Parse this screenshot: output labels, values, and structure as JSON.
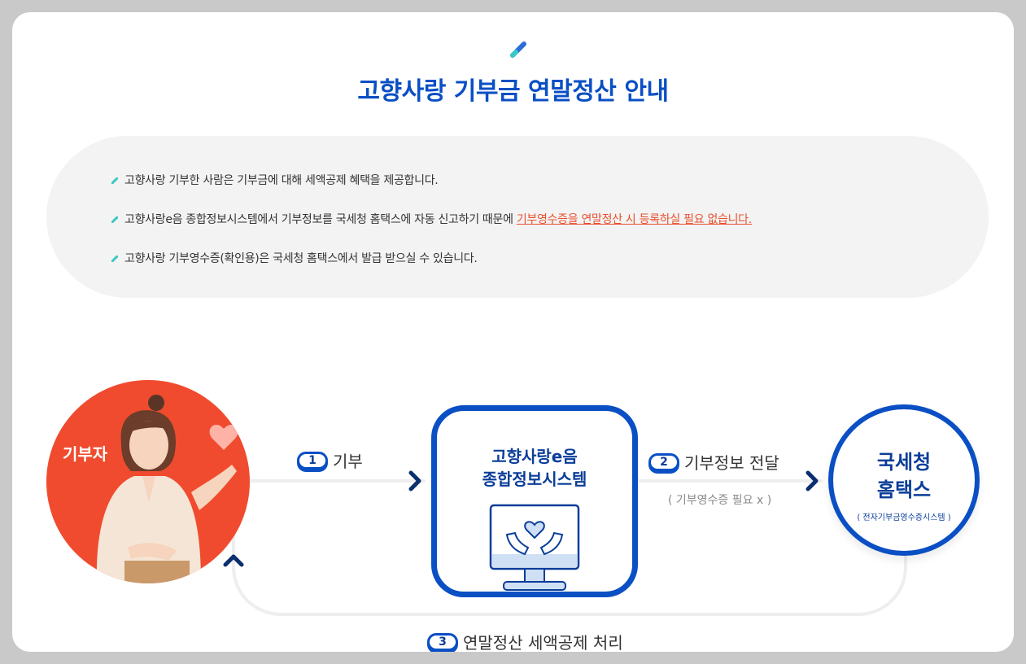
{
  "page": {
    "title": "고향사랑 기부금 연말정산 안내"
  },
  "info": {
    "items": [
      {
        "text": "고향사랑 기부한 사람은 기부금에 대해 세액공제 혜택을 제공합니다."
      },
      {
        "text": "고향사랑e음 종합정보시스템에서 기부정보를 국세청 홈택스에 자동 신고하기 때문에 ",
        "highlight": "기부영수증을 연말정산 시 등록하실 필요 없습니다."
      },
      {
        "text": "고향사랑 기부영수증(확인용)은 국세청 홈택스에서 발급 받으실 수 있습니다."
      }
    ]
  },
  "diagram": {
    "donor_label": "기부자",
    "system_title_line1": "고향사랑e음",
    "system_title_line2": "종합정보시스템",
    "nts_title_line1": "국세청",
    "nts_title_line2": "홈택스",
    "nts_subtitle": "( 전자기부금영수증시스템 )",
    "steps": [
      {
        "num": "1",
        "label": "기부"
      },
      {
        "num": "2",
        "label": "기부정보 전달"
      },
      {
        "num": "3",
        "label": "연말정산 세액공제 처리"
      }
    ],
    "note": "( 기부영수증 필요 x )"
  },
  "colors": {
    "primary": "#0a4fc4",
    "accent": "#f04b2e",
    "highlight": "#e8502e"
  }
}
